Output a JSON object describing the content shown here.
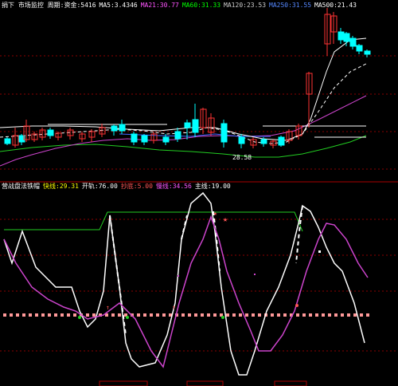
{
  "top_panel": {
    "legend": [
      {
        "text": "捐下 市场监控 周期:资金:5416",
        "color": "#ffffff"
      },
      {
        "text": "MA5:3.4346",
        "color": "#ffffff"
      },
      {
        "text": "MA21:30.77",
        "color": "#ff55ff"
      },
      {
        "text": "MA60:31.33",
        "color": "#00ff00"
      },
      {
        "text": "MA120:23.53",
        "color": "#cccccc"
      },
      {
        "text": "MA250:31.55",
        "color": "#5588ff"
      },
      {
        "text": "MA500:21.43",
        "color": "#ffffff"
      }
    ],
    "price_label": "28.58"
  },
  "bottom_panel": {
    "legend": [
      {
        "text": "营战盘法铁帽",
        "color": "#ffffff"
      },
      {
        "text": "快线:29.31",
        "color": "#ffff00"
      },
      {
        "text": "开轨:76.00",
        "color": "#ffffff"
      },
      {
        "text": "抄底:5.00",
        "color": "#ff5555"
      },
      {
        "text": "慢线:34.56",
        "color": "#ff55ff"
      },
      {
        "text": "主线:19.00",
        "color": "#ffffff"
      }
    ]
  },
  "colors": {
    "background": "#000000",
    "grid": "#8b0000",
    "up_candle": "#ff3333",
    "down_candle": "#00ffff",
    "ma_white": "#ffffff",
    "ma_magenta": "#cc44cc",
    "ma_green": "#22cc22",
    "ma_blue": "#4466ff",
    "dots": "#ff9999",
    "fast_line": "#ffffff",
    "slow_line": "#cc44cc",
    "upper_line": "#22cc22"
  },
  "icons": [
    "star-icon",
    "arrow-up-icon",
    "marker-icon"
  ]
}
